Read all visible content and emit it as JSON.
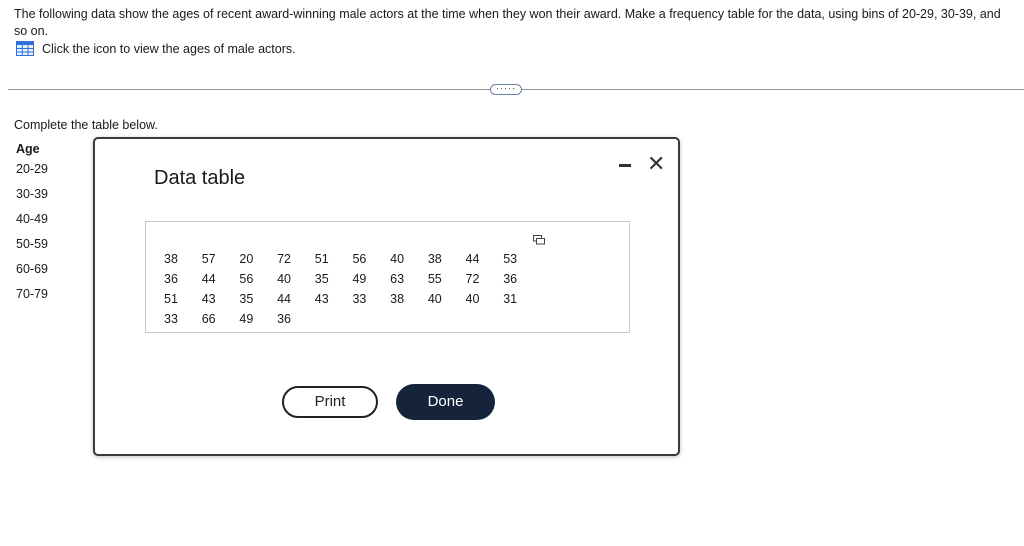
{
  "question": {
    "text": "The following data show the ages of recent award-winning male actors at the time when they won their award. Make a frequency table for the data, using bins of 20-29, 30-39, and so on.",
    "icon_instruction": "Click the icon to view the ages of male actors."
  },
  "divider": {
    "more_label": "·····"
  },
  "task": {
    "instruction": "Complete the table below.",
    "age_header": "Age",
    "age_bins": [
      "20-29",
      "30-39",
      "40-49",
      "50-59",
      "60-69",
      "70-79"
    ]
  },
  "modal": {
    "title": "Data table",
    "rows": [
      [
        "38",
        "57",
        "20",
        "72",
        "51",
        "56",
        "40",
        "38",
        "44",
        "53"
      ],
      [
        "36",
        "44",
        "56",
        "40",
        "35",
        "49",
        "63",
        "55",
        "72",
        "36"
      ],
      [
        "51",
        "43",
        "35",
        "44",
        "43",
        "33",
        "38",
        "40",
        "40",
        "31"
      ],
      [
        "33",
        "66",
        "49",
        "36",
        "",
        "",
        "",
        "",
        "",
        ""
      ]
    ],
    "print_label": "Print",
    "done_label": "Done",
    "close_glyph": "✕"
  },
  "colors": {
    "done_bg": "#15243a",
    "icon_blue": "#2f6fd6",
    "modal_border": "#3a3a3a"
  }
}
